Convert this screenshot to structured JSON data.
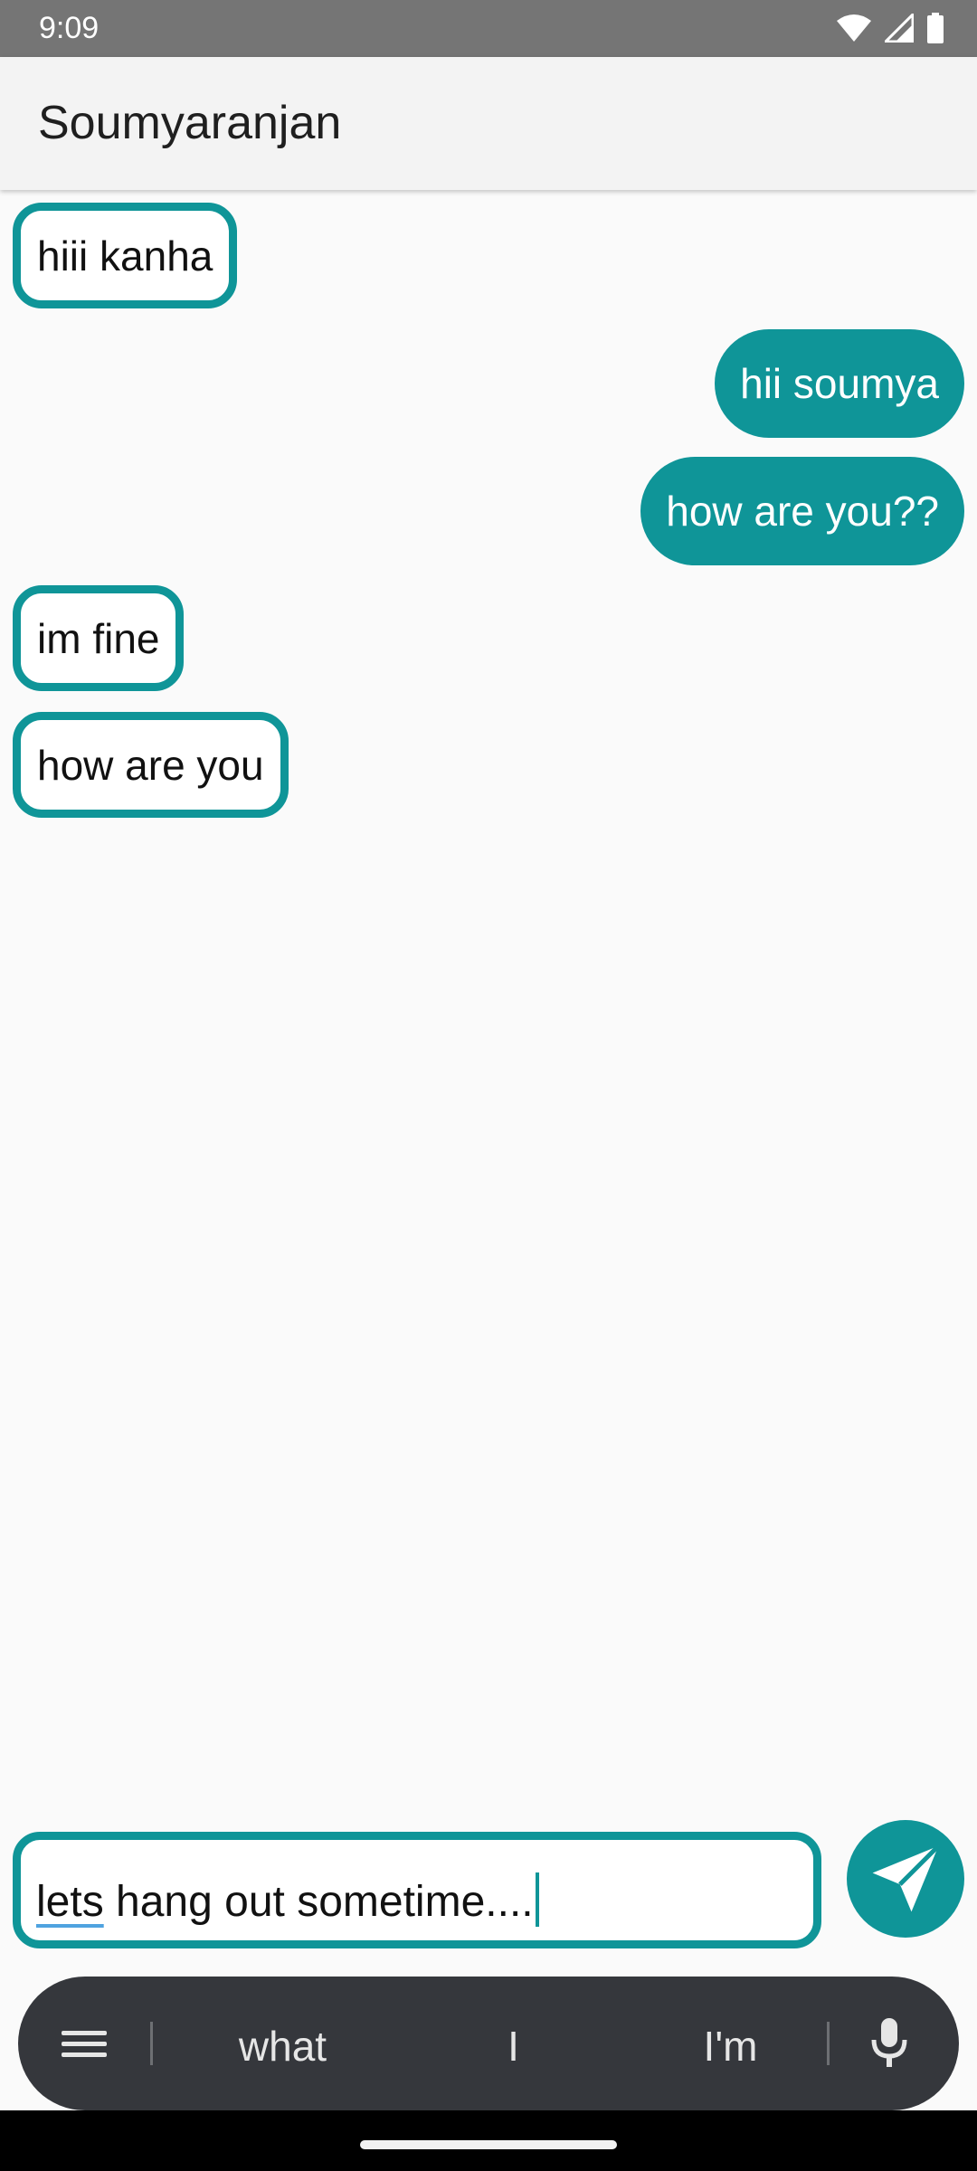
{
  "status_bar": {
    "time": "9:09",
    "icons": [
      "wifi-icon",
      "cellular-signal-icon",
      "battery-icon"
    ]
  },
  "app_bar": {
    "title": "Soumyaranjan"
  },
  "messages": [
    {
      "direction": "incoming",
      "text": "hiii kanha"
    },
    {
      "direction": "outgoing",
      "text": "hii soumya"
    },
    {
      "direction": "outgoing",
      "text": "how are you??"
    },
    {
      "direction": "incoming",
      "text": "im fine"
    },
    {
      "direction": "incoming",
      "text": "how are you"
    }
  ],
  "composer": {
    "first_word": "lets",
    "rest": " hang out sometime....",
    "send_icon": "send-icon"
  },
  "keyboard": {
    "menu_icon": "menu-icon",
    "suggestions": [
      "what",
      "I",
      "I'm"
    ],
    "mic_icon": "microphone-icon"
  },
  "colors": {
    "accent": "#0f9598",
    "status_bar": "#757575",
    "app_bar": "#f3f3f3",
    "keyboard_bar": "#35373c"
  }
}
